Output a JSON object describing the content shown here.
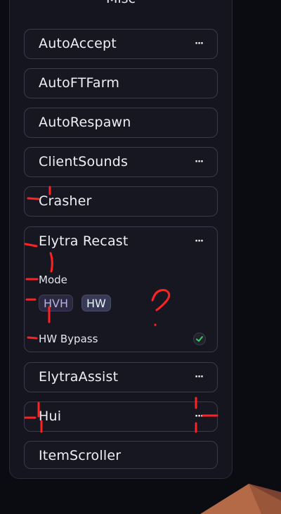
{
  "panel": {
    "title": "Misc"
  },
  "modules": [
    {
      "label": "AutoAccept",
      "has_options": true
    },
    {
      "label": "AutoFTFarm",
      "has_options": false
    },
    {
      "label": "AutoRespawn",
      "has_options": false
    },
    {
      "label": "ClientSounds",
      "has_options": true
    },
    {
      "label": "Crasher",
      "has_options": false
    },
    {
      "label": "Elytra Recast",
      "has_options": true,
      "expanded": true
    },
    {
      "label": "ElytraAssist",
      "has_options": true
    },
    {
      "label": "Hui",
      "has_options": true
    },
    {
      "label": "ItemScroller",
      "has_options": false
    }
  ],
  "elytra_recast": {
    "mode_label": "Mode",
    "mode_options": [
      "HVH",
      "HW"
    ],
    "mode_selected": "HW",
    "bypass_label": "HW Bypass",
    "bypass_checked": true
  },
  "options_glyph": "···",
  "annotation": {
    "question_mark": "?",
    "color": "#ff2a2a"
  }
}
